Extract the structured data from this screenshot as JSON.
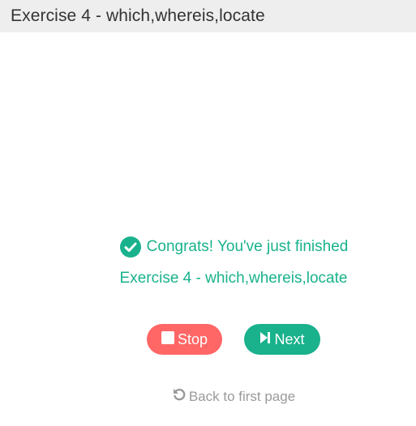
{
  "header": {
    "title": "Exercise 4 - which,whereis,locate"
  },
  "result": {
    "congrats_text": "Congrats! You've just finished",
    "exercise_name": "Exercise 4 - which,whereis,locate",
    "icon": "check-circle-icon"
  },
  "actions": {
    "stop_label": "Stop",
    "stop_icon": "stop-icon",
    "next_label": "Next",
    "next_icon": "skip-forward-icon",
    "back_label": "Back to first page",
    "back_icon": "undo-icon"
  },
  "colors": {
    "accent": "#19b28c",
    "stop": "#ff6666",
    "header_bg": "#eeeeef",
    "muted": "#9a9a9a"
  }
}
